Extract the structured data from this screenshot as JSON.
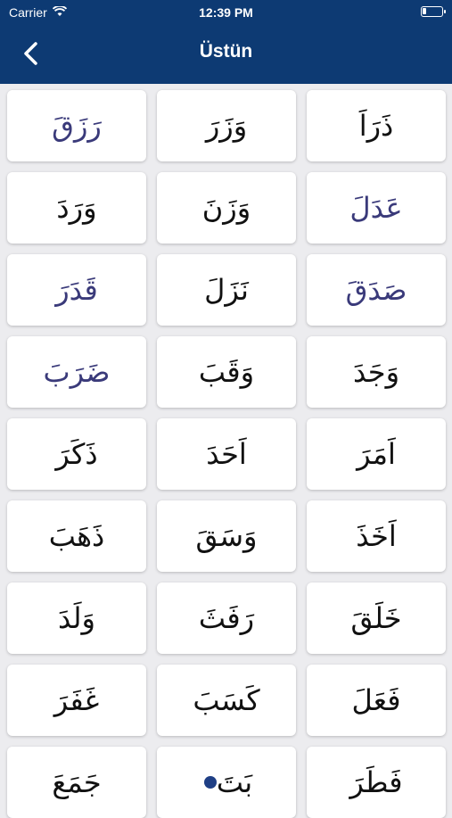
{
  "status_bar": {
    "carrier": "Carrier",
    "time": "12:39 PM",
    "wifi_icon": "wifi-icon",
    "battery_icon": "battery-icon"
  },
  "nav": {
    "title": "Üstün",
    "back_icon": "chevron-left-icon",
    "background": "#0d3a73"
  },
  "colors": {
    "accent_pink": "#e0266a",
    "navy_text": "#3a3a7a"
  },
  "grid": {
    "cells": [
      {
        "text": "رَزَقَ",
        "style": "navy"
      },
      {
        "text": "وَزَرَ",
        "style": "pink"
      },
      {
        "text": "ذَرَاَ",
        "style": "pink"
      },
      {
        "text": "وَرَدَ",
        "style": "pink"
      },
      {
        "text": "وَزَنَ",
        "style": "pink"
      },
      {
        "text": "عَدَلَ",
        "style": "navy"
      },
      {
        "text": "قَدَرَ",
        "style": "navy"
      },
      {
        "text": "نَزَلَ",
        "style": "plain"
      },
      {
        "text": "صَدَقَ",
        "style": "navy"
      },
      {
        "text": "ضَرَبَ",
        "style": "navy"
      },
      {
        "text": "وَقَبَ",
        "style": "plain"
      },
      {
        "text": "وَجَدَ",
        "style": "plain"
      },
      {
        "text": "ذَكَرَ",
        "style": "plain"
      },
      {
        "text": "اَحَدَ",
        "style": "plain"
      },
      {
        "text": "اَمَرَ",
        "style": "plain"
      },
      {
        "text": "ذَهَبَ",
        "style": "plain"
      },
      {
        "text": "وَسَقَ",
        "style": "plain"
      },
      {
        "text": "اَخَذَ",
        "style": "plain"
      },
      {
        "text": "وَلَدَ",
        "style": "plain"
      },
      {
        "text": "رَفَثَ",
        "style": "plain"
      },
      {
        "text": "خَلَقَ",
        "style": "plain"
      },
      {
        "text": "غَفَرَ",
        "style": "plain"
      },
      {
        "text": "كَسَبَ",
        "style": "plain"
      },
      {
        "text": "فَعَلَ",
        "style": "plain"
      },
      {
        "text": "جَمَعَ",
        "style": "plain"
      },
      {
        "text": "بَتَ",
        "style": "dot"
      },
      {
        "text": "فَطَرَ",
        "style": "plain"
      }
    ]
  }
}
